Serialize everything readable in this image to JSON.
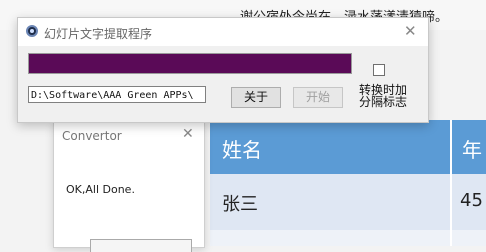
{
  "background_doc": {
    "text": "谢公宿处今尚在，渌水荡漾清猿啼。"
  },
  "background_table": {
    "headers": [
      "姓名",
      "年"
    ],
    "rows": [
      [
        "张三",
        "45"
      ]
    ],
    "header_color": "#5b9bd5",
    "row_color": "#dfe7f3"
  },
  "convertor": {
    "title": "Convertor",
    "close": "✕",
    "message": "OK,All Done."
  },
  "window": {
    "title": "幻灯片文字提取程序",
    "close": "✕",
    "progress": 1.0,
    "progress_color": "#5a0a57",
    "path_value": "D:\\Software\\AAA Green APPs\\",
    "about_label": "关于",
    "start_label": "开始",
    "toggle_label_line1": "转换时加",
    "toggle_label_line2": "分隔标志",
    "checkbox_checked": false
  }
}
